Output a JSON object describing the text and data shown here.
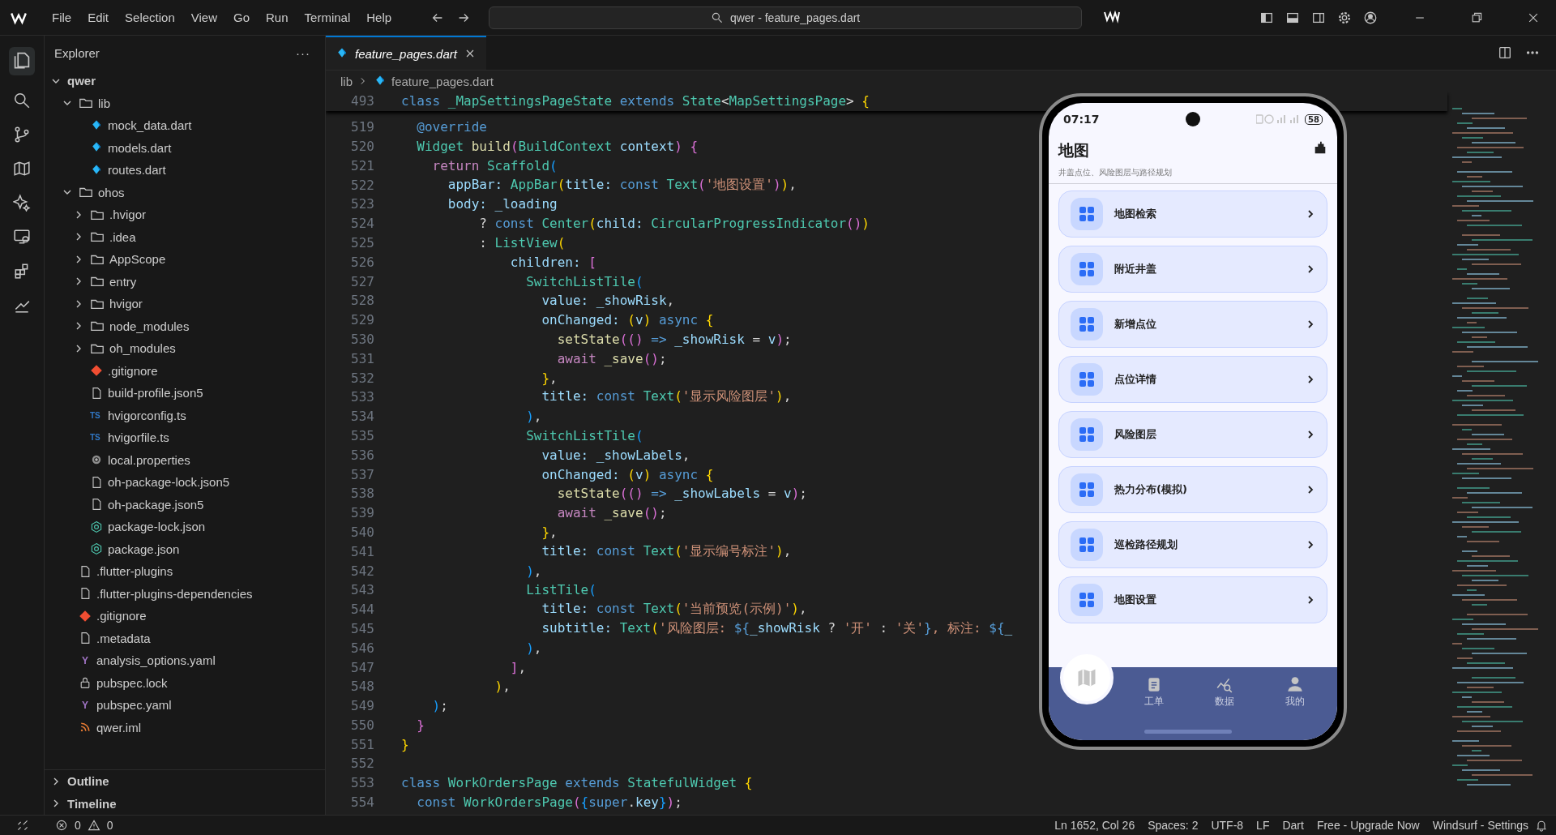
{
  "menu": [
    "File",
    "Edit",
    "Selection",
    "View",
    "Go",
    "Run",
    "Terminal",
    "Help"
  ],
  "search": {
    "value": "qwer - feature_pages.dart"
  },
  "explorer": {
    "title": "Explorer",
    "more": "···",
    "tree": [
      {
        "name": "qwer",
        "kind": "root",
        "expanded": true,
        "children": [
          {
            "name": "lib",
            "kind": "folder",
            "expanded": true,
            "children": [
              {
                "name": "mock_data.dart",
                "kind": "dart"
              },
              {
                "name": "models.dart",
                "kind": "dart"
              },
              {
                "name": "routes.dart",
                "kind": "dart"
              }
            ]
          },
          {
            "name": "ohos",
            "kind": "folder",
            "expanded": true,
            "children": [
              {
                "name": ".hvigor",
                "kind": "folder",
                "expanded": false
              },
              {
                "name": ".idea",
                "kind": "folder",
                "expanded": false
              },
              {
                "name": "AppScope",
                "kind": "folder",
                "expanded": false
              },
              {
                "name": "entry",
                "kind": "folder",
                "expanded": false
              },
              {
                "name": "hvigor",
                "kind": "folder",
                "expanded": false
              },
              {
                "name": "node_modules",
                "kind": "folder",
                "expanded": false
              },
              {
                "name": "oh_modules",
                "kind": "folder",
                "expanded": false
              },
              {
                "name": ".gitignore",
                "kind": "git"
              },
              {
                "name": "build-profile.json5",
                "kind": "file"
              },
              {
                "name": "hvigorconfig.ts",
                "kind": "ts",
                "icon_text": "TS"
              },
              {
                "name": "hvigorfile.ts",
                "kind": "ts",
                "icon_text": "TS"
              },
              {
                "name": "local.properties",
                "kind": "gear"
              },
              {
                "name": "oh-package-lock.json5",
                "kind": "file"
              },
              {
                "name": "oh-package.json5",
                "kind": "file"
              },
              {
                "name": "package-lock.json",
                "kind": "npm"
              },
              {
                "name": "package.json",
                "kind": "npm"
              }
            ]
          },
          {
            "name": ".flutter-plugins",
            "kind": "file"
          },
          {
            "name": ".flutter-plugins-dependencies",
            "kind": "file"
          },
          {
            "name": ".gitignore",
            "kind": "git"
          },
          {
            "name": ".metadata",
            "kind": "file"
          },
          {
            "name": "analysis_options.yaml",
            "kind": "yaml",
            "icon_text": "Y"
          },
          {
            "name": "pubspec.lock",
            "kind": "lock"
          },
          {
            "name": "pubspec.yaml",
            "kind": "yaml",
            "icon_text": "Y"
          },
          {
            "name": "qwer.iml",
            "kind": "rss"
          }
        ]
      }
    ],
    "sections": [
      {
        "name": "Outline",
        "expanded": false
      },
      {
        "name": "Timeline",
        "expanded": false
      }
    ]
  },
  "tabs": [
    {
      "label": "feature_pages.dart",
      "selected": true
    }
  ],
  "breadcrumb": [
    "lib",
    "feature_pages.dart"
  ],
  "sticky_line": {
    "number": "493",
    "segments": [
      {
        "text": "class ",
        "kind": "kw"
      },
      {
        "text": "_MapSettingsPageState ",
        "kind": "type"
      },
      {
        "text": "extends ",
        "kind": "kw"
      },
      {
        "text": "State",
        "kind": "type"
      },
      {
        "text": "<",
        "kind": "plain"
      },
      {
        "text": "MapSettingsPage",
        "kind": "type"
      },
      {
        "text": "> ",
        "kind": "plain"
      },
      {
        "text": "{",
        "kind": "b1"
      }
    ]
  },
  "code_lines": [
    {
      "number": "519",
      "segments": [
        {
          "text": "  @override",
          "kind": "kw"
        }
      ]
    },
    {
      "number": "520",
      "segments": [
        {
          "text": "  Widget ",
          "kind": "type"
        },
        {
          "text": "build",
          "kind": "fn"
        },
        {
          "text": "(",
          "kind": "b2"
        },
        {
          "text": "BuildContext ",
          "kind": "type"
        },
        {
          "text": "context",
          "kind": "var"
        },
        {
          "text": ") {",
          "kind": "b2"
        }
      ]
    },
    {
      "number": "521",
      "segments": [
        {
          "text": "    return ",
          "kind": "ctl"
        },
        {
          "text": "Scaffold",
          "kind": "type"
        },
        {
          "text": "(",
          "kind": "b3"
        }
      ]
    },
    {
      "number": "522",
      "segments": [
        {
          "text": "      appBar: ",
          "kind": "var"
        },
        {
          "text": "AppBar",
          "kind": "type"
        },
        {
          "text": "(",
          "kind": "b1"
        },
        {
          "text": "title: ",
          "kind": "var"
        },
        {
          "text": "const ",
          "kind": "kw"
        },
        {
          "text": "Text",
          "kind": "type"
        },
        {
          "text": "(",
          "kind": "b2"
        },
        {
          "text": "'地图设置'",
          "kind": "str"
        },
        {
          "text": ")",
          "kind": "b2"
        },
        {
          "text": ")",
          "kind": "b1"
        },
        {
          "text": ",",
          "kind": "plain"
        }
      ]
    },
    {
      "number": "523",
      "segments": [
        {
          "text": "      body: _loading",
          "kind": "var"
        }
      ]
    },
    {
      "number": "524",
      "segments": [
        {
          "text": "          ? ",
          "kind": "plain"
        },
        {
          "text": "const ",
          "kind": "kw"
        },
        {
          "text": "Center",
          "kind": "type"
        },
        {
          "text": "(",
          "kind": "b1"
        },
        {
          "text": "child: ",
          "kind": "var"
        },
        {
          "text": "CircularProgressIndicator",
          "kind": "type"
        },
        {
          "text": "()",
          "kind": "b2"
        },
        {
          "text": ")",
          "kind": "b1"
        }
      ]
    },
    {
      "number": "525",
      "segments": [
        {
          "text": "          : ",
          "kind": "plain"
        },
        {
          "text": "ListView",
          "kind": "type"
        },
        {
          "text": "(",
          "kind": "b1"
        }
      ]
    },
    {
      "number": "526",
      "segments": [
        {
          "text": "              children: ",
          "kind": "var"
        },
        {
          "text": "[",
          "kind": "b2"
        }
      ]
    },
    {
      "number": "527",
      "segments": [
        {
          "text": "                SwitchListTile",
          "kind": "type"
        },
        {
          "text": "(",
          "kind": "b3"
        }
      ]
    },
    {
      "number": "528",
      "segments": [
        {
          "text": "                  value: _showRisk",
          "kind": "var"
        },
        {
          "text": ",",
          "kind": "plain"
        }
      ]
    },
    {
      "number": "529",
      "segments": [
        {
          "text": "                  onChanged: ",
          "kind": "var"
        },
        {
          "text": "(",
          "kind": "b1"
        },
        {
          "text": "v",
          "kind": "var"
        },
        {
          "text": ")",
          "kind": "b1"
        },
        {
          "text": " async ",
          "kind": "kw"
        },
        {
          "text": "{",
          "kind": "b1"
        }
      ]
    },
    {
      "number": "530",
      "segments": [
        {
          "text": "                    setState",
          "kind": "fn"
        },
        {
          "text": "(()",
          "kind": "b2"
        },
        {
          "text": " => ",
          "kind": "kw"
        },
        {
          "text": "_showRisk ",
          "kind": "var"
        },
        {
          "text": "= ",
          "kind": "plain"
        },
        {
          "text": "v",
          "kind": "var"
        },
        {
          "text": ")",
          "kind": "b2"
        },
        {
          "text": ";",
          "kind": "plain"
        }
      ]
    },
    {
      "number": "531",
      "segments": [
        {
          "text": "                    await ",
          "kind": "ctl"
        },
        {
          "text": "_save",
          "kind": "fn"
        },
        {
          "text": "()",
          "kind": "b2"
        },
        {
          "text": ";",
          "kind": "plain"
        }
      ]
    },
    {
      "number": "532",
      "segments": [
        {
          "text": "                  }",
          "kind": "b1"
        },
        {
          "text": ",",
          "kind": "plain"
        }
      ]
    },
    {
      "number": "533",
      "segments": [
        {
          "text": "                  title: ",
          "kind": "var"
        },
        {
          "text": "const ",
          "kind": "kw"
        },
        {
          "text": "Text",
          "kind": "type"
        },
        {
          "text": "(",
          "kind": "b1"
        },
        {
          "text": "'显示风险图层'",
          "kind": "str"
        },
        {
          "text": ")",
          "kind": "b1"
        },
        {
          "text": ",",
          "kind": "plain"
        }
      ]
    },
    {
      "number": "534",
      "segments": [
        {
          "text": "                )",
          "kind": "b3"
        },
        {
          "text": ",",
          "kind": "plain"
        }
      ]
    },
    {
      "number": "535",
      "segments": [
        {
          "text": "                SwitchListTile",
          "kind": "type"
        },
        {
          "text": "(",
          "kind": "b3"
        }
      ]
    },
    {
      "number": "536",
      "segments": [
        {
          "text": "                  value: _showLabels",
          "kind": "var"
        },
        {
          "text": ",",
          "kind": "plain"
        }
      ]
    },
    {
      "number": "537",
      "segments": [
        {
          "text": "                  onChanged: ",
          "kind": "var"
        },
        {
          "text": "(",
          "kind": "b1"
        },
        {
          "text": "v",
          "kind": "var"
        },
        {
          "text": ")",
          "kind": "b1"
        },
        {
          "text": " async ",
          "kind": "kw"
        },
        {
          "text": "{",
          "kind": "b1"
        }
      ]
    },
    {
      "number": "538",
      "segments": [
        {
          "text": "                    setState",
          "kind": "fn"
        },
        {
          "text": "(()",
          "kind": "b2"
        },
        {
          "text": " => ",
          "kind": "kw"
        },
        {
          "text": "_showLabels ",
          "kind": "var"
        },
        {
          "text": "= ",
          "kind": "plain"
        },
        {
          "text": "v",
          "kind": "var"
        },
        {
          "text": ")",
          "kind": "b2"
        },
        {
          "text": ";",
          "kind": "plain"
        }
      ]
    },
    {
      "number": "539",
      "segments": [
        {
          "text": "                    await ",
          "kind": "ctl"
        },
        {
          "text": "_save",
          "kind": "fn"
        },
        {
          "text": "()",
          "kind": "b2"
        },
        {
          "text": ";",
          "kind": "plain"
        }
      ]
    },
    {
      "number": "540",
      "segments": [
        {
          "text": "                  }",
          "kind": "b1"
        },
        {
          "text": ",",
          "kind": "plain"
        }
      ]
    },
    {
      "number": "541",
      "segments": [
        {
          "text": "                  title: ",
          "kind": "var"
        },
        {
          "text": "const ",
          "kind": "kw"
        },
        {
          "text": "Text",
          "kind": "type"
        },
        {
          "text": "(",
          "kind": "b1"
        },
        {
          "text": "'显示编号标注'",
          "kind": "str"
        },
        {
          "text": ")",
          "kind": "b1"
        },
        {
          "text": ",",
          "kind": "plain"
        }
      ]
    },
    {
      "number": "542",
      "segments": [
        {
          "text": "                )",
          "kind": "b3"
        },
        {
          "text": ",",
          "kind": "plain"
        }
      ]
    },
    {
      "number": "543",
      "segments": [
        {
          "text": "                ListTile",
          "kind": "type"
        },
        {
          "text": "(",
          "kind": "b3"
        }
      ]
    },
    {
      "number": "544",
      "segments": [
        {
          "text": "                  title: ",
          "kind": "var"
        },
        {
          "text": "const ",
          "kind": "kw"
        },
        {
          "text": "Text",
          "kind": "type"
        },
        {
          "text": "(",
          "kind": "b1"
        },
        {
          "text": "'当前预览(示例)'",
          "kind": "str"
        },
        {
          "text": ")",
          "kind": "b1"
        },
        {
          "text": ",",
          "kind": "plain"
        }
      ]
    },
    {
      "number": "545",
      "segments": [
        {
          "text": "                  subtitle: ",
          "kind": "var"
        },
        {
          "text": "Text",
          "kind": "type"
        },
        {
          "text": "(",
          "kind": "b1"
        },
        {
          "text": "'风险图层: ",
          "kind": "str"
        },
        {
          "text": "${",
          "kind": "kw"
        },
        {
          "text": "_showRisk ",
          "kind": "var"
        },
        {
          "text": "? ",
          "kind": "plain"
        },
        {
          "text": "'开' ",
          "kind": "str"
        },
        {
          "text": ": ",
          "kind": "plain"
        },
        {
          "text": "'关'",
          "kind": "str"
        },
        {
          "text": "}",
          "kind": "kw"
        },
        {
          "text": ", 标注: ",
          "kind": "str"
        },
        {
          "text": "${",
          "kind": "kw"
        },
        {
          "text": "_",
          "kind": "var"
        }
      ]
    },
    {
      "number": "546",
      "segments": [
        {
          "text": "                )",
          "kind": "b3"
        },
        {
          "text": ",",
          "kind": "plain"
        }
      ]
    },
    {
      "number": "547",
      "segments": [
        {
          "text": "              ]",
          "kind": "b2"
        },
        {
          "text": ",",
          "kind": "plain"
        }
      ]
    },
    {
      "number": "548",
      "segments": [
        {
          "text": "            )",
          "kind": "b1"
        },
        {
          "text": ",",
          "kind": "plain"
        }
      ]
    },
    {
      "number": "549",
      "segments": [
        {
          "text": "    )",
          "kind": "b3"
        },
        {
          "text": ";",
          "kind": "plain"
        }
      ]
    },
    {
      "number": "550",
      "segments": [
        {
          "text": "  }",
          "kind": "b2"
        }
      ]
    },
    {
      "number": "551",
      "segments": [
        {
          "text": "}",
          "kind": "b1"
        }
      ]
    },
    {
      "number": "552"
    },
    {
      "number": "553",
      "segments": [
        {
          "text": "class ",
          "kind": "kw"
        },
        {
          "text": "WorkOrdersPage ",
          "kind": "type"
        },
        {
          "text": "extends ",
          "kind": "kw"
        },
        {
          "text": "StatefulWidget ",
          "kind": "type"
        },
        {
          "text": "{",
          "kind": "b1"
        }
      ]
    },
    {
      "number": "554",
      "segments": [
        {
          "text": "  const ",
          "kind": "kw"
        },
        {
          "text": "WorkOrdersPage",
          "kind": "type"
        },
        {
          "text": "(",
          "kind": "b2"
        },
        {
          "text": "{",
          "kind": "b3"
        },
        {
          "text": "super",
          "kind": "kw"
        },
        {
          "text": ".",
          "kind": "plain"
        },
        {
          "text": "key",
          "kind": "var"
        },
        {
          "text": "}",
          "kind": "b3"
        },
        {
          "text": ")",
          "kind": "b2"
        },
        {
          "text": ";",
          "kind": "plain"
        }
      ]
    }
  ],
  "phone": {
    "time": "07:17",
    "battery": "58",
    "title": "地图",
    "subtitle": "井盖点位、风险图层与路径规划",
    "items": [
      "地图检索",
      "附近井盖",
      "新增点位",
      "点位详情",
      "风险图层",
      "热力分布(模拟)",
      "巡检路径规划",
      "地图设置"
    ],
    "nav": [
      {
        "kind": "map",
        "selected": true
      },
      {
        "kind": "clipboard",
        "label": "工单",
        "selected": false
      },
      {
        "kind": "chart",
        "label": "数据",
        "selected": false
      },
      {
        "kind": "person",
        "label": "我的",
        "selected": false
      }
    ]
  },
  "status_bar": {
    "errors": "0",
    "warnings": "0",
    "items": [
      "Ln 1652, Col 26",
      "Spaces: 2",
      "UTF-8",
      "LF",
      "Dart",
      "Free - Upgrade Now",
      "Windsurf - Settings"
    ]
  }
}
